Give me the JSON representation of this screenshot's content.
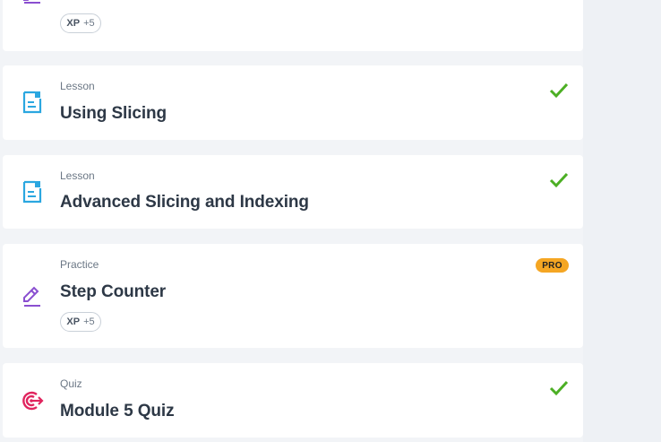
{
  "colors": {
    "lesson_icon": "#2ba7e0",
    "practice_icon": "#8a4fd0",
    "quiz_icon": "#e0245e",
    "check": "#4caf24",
    "pro_badge": "#f5a623"
  },
  "cards": [
    {
      "type": "",
      "title": "",
      "icon": "pencil-icon",
      "xp_label": "XP",
      "xp_value": "+5",
      "status": "none"
    },
    {
      "type": "Lesson",
      "title": "Using Slicing",
      "icon": "document-icon",
      "status": "completed"
    },
    {
      "type": "Lesson",
      "title": "Advanced Slicing and Indexing",
      "icon": "document-icon",
      "status": "completed"
    },
    {
      "type": "Practice",
      "title": "Step Counter",
      "icon": "pencil-icon",
      "xp_label": "XP",
      "xp_value": "+5",
      "badge": "PRO",
      "status": "locked"
    },
    {
      "type": "Quiz",
      "title": "Module 5 Quiz",
      "icon": "target-icon",
      "status": "completed"
    }
  ]
}
